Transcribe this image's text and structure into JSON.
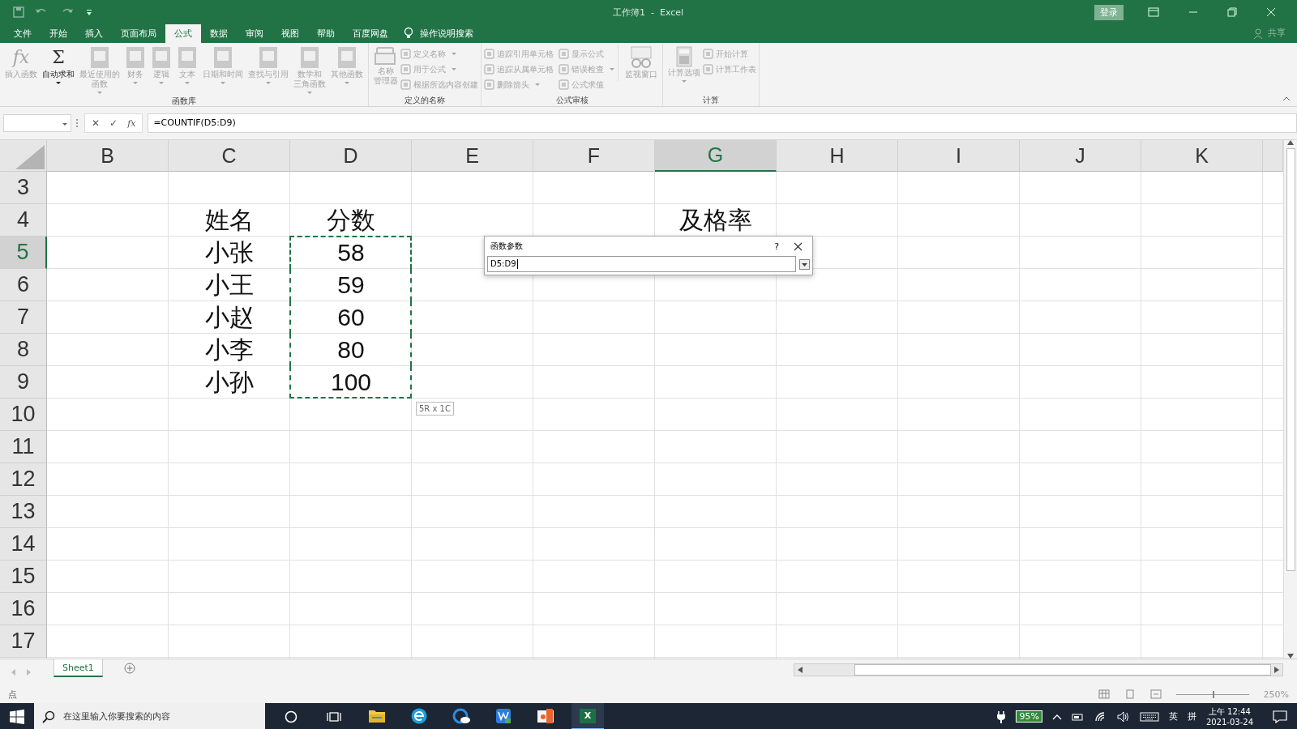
{
  "window": {
    "title": "工作簿1  -  Excel",
    "login": "登录",
    "share": "共享"
  },
  "tabs": [
    {
      "label": "文件",
      "selected": false
    },
    {
      "label": "开始",
      "selected": false
    },
    {
      "label": "插入",
      "selected": false
    },
    {
      "label": "页面布局",
      "selected": false
    },
    {
      "label": "公式",
      "selected": true
    },
    {
      "label": "数据",
      "selected": false
    },
    {
      "label": "审阅",
      "selected": false
    },
    {
      "label": "视图",
      "selected": false
    },
    {
      "label": "帮助",
      "selected": false
    },
    {
      "label": "百度网盘",
      "selected": false
    }
  ],
  "tell_me": "操作说明搜索",
  "ribbon": [
    {
      "label": "函数库",
      "large": [
        {
          "kind": "glyph",
          "glyph": "fx",
          "label": "插入函数",
          "disabled": true,
          "menu": false
        },
        {
          "kind": "glyph",
          "glyph": "Σ",
          "label": "自动求和",
          "disabled": false,
          "menu": true
        },
        {
          "kind": "book",
          "label": "最近使用的",
          "label_2": "函数",
          "disabled": true,
          "menu": true
        },
        {
          "kind": "book",
          "label": "财务",
          "disabled": true,
          "menu": true
        },
        {
          "kind": "book",
          "label": "逻辑",
          "disabled": true,
          "menu": true
        },
        {
          "kind": "book",
          "label": "文本",
          "disabled": true,
          "menu": true
        },
        {
          "kind": "book",
          "label": "日期和时间",
          "disabled": true,
          "menu": true
        },
        {
          "kind": "book",
          "label": "查找与引用",
          "disabled": true,
          "menu": true
        },
        {
          "kind": "book",
          "label": "数学和",
          "label_2": "三角函数",
          "disabled": true,
          "menu": true
        },
        {
          "kind": "book",
          "label": "其他函数",
          "disabled": true,
          "menu": true
        }
      ]
    },
    {
      "label": "定义的名称",
      "large": [
        {
          "kind": "cards",
          "label": "名称",
          "label_2": "管理器",
          "disabled": true,
          "menu": false
        }
      ],
      "small": [
        {
          "label": "定义名称",
          "disabled": true,
          "menu": true
        },
        {
          "label": "用于公式",
          "disabled": true,
          "menu": true
        },
        {
          "label": "根据所选内容创建",
          "disabled": true,
          "menu": false
        }
      ]
    },
    {
      "label": "公式审核",
      "small": [
        {
          "label": "追踪引用单元格",
          "disabled": true,
          "menu": false
        },
        {
          "label": "追踪从属单元格",
          "disabled": true,
          "menu": false
        },
        {
          "label": "删除箭头",
          "disabled": true,
          "menu": true
        },
        {
          "label": "显示公式",
          "disabled": true,
          "menu": false
        },
        {
          "label": "错误检查",
          "disabled": true,
          "menu": true
        },
        {
          "label": "公式求值",
          "disabled": true,
          "menu": false
        }
      ],
      "after": [
        {
          "kind": "watch",
          "label": "监视窗口",
          "disabled": true
        }
      ]
    },
    {
      "label": "计算",
      "large": [
        {
          "kind": "calc",
          "label": "计算选项",
          "disabled": true,
          "menu": true
        }
      ],
      "small": [
        {
          "label": "开始计算",
          "disabled": true,
          "menu": false
        },
        {
          "label": "计算工作表",
          "disabled": true,
          "menu": false
        }
      ]
    }
  ],
  "formula_bar": {
    "cancel": "✕",
    "enter": "✓",
    "fx": "fx",
    "formula": "=COUNTIF(D5:D9)"
  },
  "columns": [
    {
      "label": "B",
      "selected": false
    },
    {
      "label": "C",
      "selected": false
    },
    {
      "label": "D",
      "selected": false
    },
    {
      "label": "E",
      "selected": false
    },
    {
      "label": "F",
      "selected": false
    },
    {
      "label": "G",
      "selected": true
    },
    {
      "label": "H",
      "selected": false
    },
    {
      "label": "I",
      "selected": false
    },
    {
      "label": "J",
      "selected": false
    },
    {
      "label": "K",
      "selected": false
    }
  ],
  "rows": [
    {
      "header": "3",
      "selected": false,
      "marked": false
    },
    {
      "header": "4",
      "selected": false,
      "marked": false,
      "name": "姓名",
      "score": "分数",
      "g": "及格率"
    },
    {
      "header": "5",
      "selected": true,
      "marked": true,
      "name": "小张",
      "score": "58"
    },
    {
      "header": "6",
      "selected": false,
      "marked": true,
      "name": "小王",
      "score": "59"
    },
    {
      "header": "7",
      "selected": false,
      "marked": true,
      "name": "小赵",
      "score": "60"
    },
    {
      "header": "8",
      "selected": false,
      "marked": true,
      "name": "小李",
      "score": "80"
    },
    {
      "header": "9",
      "selected": false,
      "marked": true,
      "name": "小孙",
      "score": "100"
    },
    {
      "header": "10",
      "selected": false,
      "marked": false
    },
    {
      "header": "11",
      "selected": false,
      "marked": false
    },
    {
      "header": "12",
      "selected": false,
      "marked": false
    },
    {
      "header": "13",
      "selected": false,
      "marked": false
    },
    {
      "header": "14",
      "selected": false,
      "marked": false
    },
    {
      "header": "15",
      "selected": false,
      "marked": false
    },
    {
      "header": "16",
      "selected": false,
      "marked": false
    },
    {
      "header": "17",
      "selected": false,
      "marked": false
    }
  ],
  "dialog": {
    "title": "函数参数",
    "help": "?",
    "value": "D5:D9"
  },
  "tooltip": "5R x 1C",
  "sheets": [
    {
      "label": "Sheet1",
      "selected": true
    }
  ],
  "status": {
    "mode": "点",
    "zoom": "250%",
    "zoom_slider": {
      "level": 0.5
    }
  },
  "taskbar": {
    "search_placeholder": "在这里输入你要搜索的内容",
    "apps": [
      {
        "kind": "files",
        "selected": false
      },
      {
        "kind": "browser",
        "selected": false
      },
      {
        "kind": "edge",
        "selected": false
      },
      {
        "kind": "writer",
        "selected": false
      },
      {
        "kind": "slides",
        "selected": false
      },
      {
        "kind": "excel",
        "glyph": "X",
        "selected": true
      }
    ],
    "battery": "95%",
    "ime": "英",
    "ime_mode": "拼",
    "time": "上午 12:44",
    "date": "2021-03-24"
  }
}
